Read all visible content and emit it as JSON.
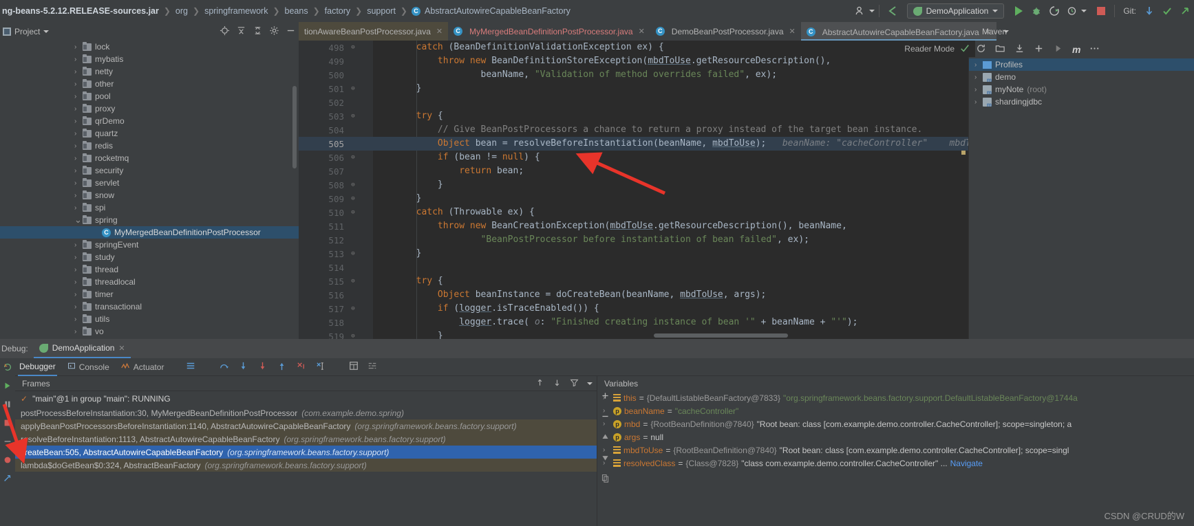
{
  "breadcrumb": {
    "jar": "ng-beans-5.2.12.RELEASE-sources.jar",
    "items": [
      "org",
      "springframework",
      "beans",
      "factory",
      "support"
    ],
    "class": "AbstractAutowireCapableBeanFactory",
    "class_icon": "C"
  },
  "toolbar": {
    "user_icon": "user-icon",
    "back_icon": "back-arrow-icon",
    "run_config": "DemoApplication",
    "run_icon": "run-icon",
    "debug_icon": "debug-icon",
    "coverage_icon": "run-with-coverage-icon",
    "profiler_icon": "profiler-icon",
    "stop_icon": "stop-icon",
    "git_label": "Git:",
    "git_update_icon": "git-update-icon",
    "git_commit_icon": "git-commit-icon",
    "git_push_icon": "git-push-icon"
  },
  "project_panel": {
    "title": "Project",
    "tools": [
      "locate-icon",
      "collapse-all-icon",
      "expand-icon",
      "settings-gear-icon",
      "hide-icon"
    ],
    "tree": [
      {
        "label": "lock",
        "type": "folder",
        "expanded": false
      },
      {
        "label": "mybatis",
        "type": "folder",
        "expanded": false
      },
      {
        "label": "netty",
        "type": "folder",
        "expanded": false
      },
      {
        "label": "other",
        "type": "folder",
        "expanded": false
      },
      {
        "label": "pool",
        "type": "folder",
        "expanded": false
      },
      {
        "label": "proxy",
        "type": "folder",
        "expanded": false
      },
      {
        "label": "qrDemo",
        "type": "folder",
        "expanded": false
      },
      {
        "label": "quartz",
        "type": "folder",
        "expanded": false
      },
      {
        "label": "redis",
        "type": "folder",
        "expanded": false
      },
      {
        "label": "rocketmq",
        "type": "folder",
        "expanded": false
      },
      {
        "label": "security",
        "type": "folder",
        "expanded": false
      },
      {
        "label": "servlet",
        "type": "folder",
        "expanded": false
      },
      {
        "label": "snow",
        "type": "folder",
        "expanded": false
      },
      {
        "label": "spi",
        "type": "folder",
        "expanded": false
      },
      {
        "label": "spring",
        "type": "folder",
        "expanded": true
      },
      {
        "label": "MyMergedBeanDefinitionPostProcessor",
        "type": "class",
        "selected": true
      },
      {
        "label": "springEvent",
        "type": "folder",
        "expanded": false
      },
      {
        "label": "study",
        "type": "folder",
        "expanded": false
      },
      {
        "label": "thread",
        "type": "folder",
        "expanded": false
      },
      {
        "label": "threadlocal",
        "type": "folder",
        "expanded": false
      },
      {
        "label": "timer",
        "type": "folder",
        "expanded": false
      },
      {
        "label": "transactional",
        "type": "folder",
        "expanded": false
      },
      {
        "label": "utils",
        "type": "folder",
        "expanded": false
      },
      {
        "label": "vo",
        "type": "folder",
        "expanded": false
      }
    ]
  },
  "editor_tabs": [
    {
      "label": "tionAwareBeanPostProcessor.java",
      "style": "olive",
      "icon": "",
      "closable": true
    },
    {
      "label": "MyMergedBeanDefinitionPostProcessor.java",
      "style": "pink",
      "icon": "C",
      "closable": true
    },
    {
      "label": "DemoBeanPostProcessor.java",
      "style": "normal",
      "icon": "C",
      "closable": true
    },
    {
      "label": "AbstractAutowireCapableBeanFactory.java",
      "style": "active",
      "icon": "C",
      "closable": true
    }
  ],
  "editor": {
    "reader_mode": "Reader Mode",
    "inspection_icon": "inspections-ok-icon",
    "lines": [
      {
        "num": "498",
        "fold": "⊖",
        "code_html": "        catch (BeanDefinitionValidationException ex) {",
        "plain": "catch (BeanDefinitionValidationException ex) {"
      },
      {
        "num": "499",
        "fold": "",
        "code_html": "            throw new BeanDefinitionStoreException(mbdToUse.getResourceDescription(),",
        "plain": "throw new BeanDefinitionStoreException(mbdToUse.getResourceDescription(),"
      },
      {
        "num": "500",
        "fold": "",
        "code_html": "                    beanName, \"Validation of method overrides failed\", ex);",
        "plain": "beanName, \"Validation of method overrides failed\", ex);"
      },
      {
        "num": "501",
        "fold": "⊖",
        "code_html": "        }",
        "plain": "}"
      },
      {
        "num": "502",
        "fold": "",
        "code_html": "",
        "plain": ""
      },
      {
        "num": "503",
        "fold": "⊖",
        "code_html": "        try {",
        "plain": "try {"
      },
      {
        "num": "504",
        "fold": "",
        "code_html": "            // Give BeanPostProcessors a chance to return a proxy instead of the target bean instance.",
        "plain": "// Give BeanPostProcessors a chance to return a proxy instead of the target bean instance."
      },
      {
        "num": "505",
        "fold": "",
        "code_html": "            Object bean = resolveBeforeInstantiation(beanName, mbdToUse);",
        "plain": "Object bean = resolveBeforeInstantiation(beanName, mbdToUse);",
        "highlighted": true,
        "hints": "beanName: \"cacheController\"    mbdToUse: \"Root b"
      },
      {
        "num": "506",
        "fold": "⊖",
        "code_html": "            if (bean != null) {",
        "plain": "if (bean != null) {"
      },
      {
        "num": "507",
        "fold": "",
        "code_html": "                return bean;",
        "plain": "return bean;"
      },
      {
        "num": "508",
        "fold": "⊖",
        "code_html": "            }",
        "plain": "}"
      },
      {
        "num": "509",
        "fold": "⊖",
        "code_html": "        }",
        "plain": "}"
      },
      {
        "num": "510",
        "fold": "⊖",
        "code_html": "        catch (Throwable ex) {",
        "plain": "catch (Throwable ex) {"
      },
      {
        "num": "511",
        "fold": "",
        "code_html": "            throw new BeanCreationException(mbdToUse.getResourceDescription(), beanName,",
        "plain": "throw new BeanCreationException(mbdToUse.getResourceDescription(), beanName,"
      },
      {
        "num": "512",
        "fold": "",
        "code_html": "                    \"BeanPostProcessor before instantiation of bean failed\", ex);",
        "plain": "\"BeanPostProcessor before instantiation of bean failed\", ex);"
      },
      {
        "num": "513",
        "fold": "⊖",
        "code_html": "        }",
        "plain": "}"
      },
      {
        "num": "514",
        "fold": "",
        "code_html": "",
        "plain": ""
      },
      {
        "num": "515",
        "fold": "⊖",
        "code_html": "        try {",
        "plain": "try {"
      },
      {
        "num": "516",
        "fold": "",
        "code_html": "            Object beanInstance = doCreateBean(beanName, mbdToUse, args);",
        "plain": "Object beanInstance = doCreateBean(beanName, mbdToUse, args);"
      },
      {
        "num": "517",
        "fold": "⊖",
        "code_html": "            if (logger.isTraceEnabled()) {",
        "plain": "if (logger.isTraceEnabled()) {"
      },
      {
        "num": "518",
        "fold": "",
        "code_html": "                logger.trace( o: \"Finished creating instance of bean '\" + beanName + \"'\");",
        "plain": "logger.trace( o: \"Finished creating instance of bean '\" + beanName + \"'\");"
      },
      {
        "num": "519",
        "fold": "⊖",
        "code_html": "            }",
        "plain": "}"
      }
    ]
  },
  "maven_panel": {
    "title": "Maven",
    "tools": [
      "reload-icon",
      "add-maven-project-icon",
      "download-sources-icon",
      "add-icon",
      "run-icon",
      "execute-goal-icon",
      "more-icon"
    ],
    "tree": [
      {
        "label": "Profiles",
        "icon": "profiles-icon",
        "selected": true,
        "suffix": ""
      },
      {
        "label": "demo",
        "icon": "maven-module-icon",
        "selected": false,
        "suffix": ""
      },
      {
        "label": "myNote",
        "icon": "maven-module-icon",
        "selected": false,
        "suffix": "(root)"
      },
      {
        "label": "shardingjdbc",
        "icon": "maven-module-icon",
        "selected": false,
        "suffix": ""
      }
    ]
  },
  "debug_panel": {
    "window_label": "Debug:",
    "session_name": "DemoApplication",
    "tabs": [
      {
        "label": "Debugger",
        "active": true,
        "icon": ""
      },
      {
        "label": "Console",
        "active": false,
        "icon": "console-icon"
      },
      {
        "label": "Actuator",
        "active": false,
        "icon": "actuator-icon"
      }
    ],
    "tools": [
      "layout-icon",
      "step-over-icon",
      "step-into-icon",
      "force-step-into-icon",
      "step-out-icon",
      "drop-frame-icon",
      "run-to-cursor-icon",
      "evaluate-icon",
      "settings-icon"
    ],
    "frames": {
      "header": "Frames",
      "thread": "\"main\"@1 in group \"main\": RUNNING",
      "tools": [
        "sort-up-icon",
        "sort-down-icon",
        "filter-icon",
        "chevron-down-icon"
      ],
      "rows": [
        {
          "method": "postProcessBeforeInstantiation:30, MyMergedBeanDefinitionPostProcessor",
          "pkg": "(com.example.demo.spring)",
          "style": "normal"
        },
        {
          "method": "applyBeanPostProcessorsBeforeInstantiation:1140, AbstractAutowireCapableBeanFactory",
          "pkg": "(org.springframework.beans.factory.support)",
          "style": "olive"
        },
        {
          "method": "resolveBeforeInstantiation:1113, AbstractAutowireCapableBeanFactory",
          "pkg": "(org.springframework.beans.factory.support)",
          "style": "olive"
        },
        {
          "method": "createBean:505, AbstractAutowireCapableBeanFactory",
          "pkg": "(org.springframework.beans.factory.support)",
          "style": "selected"
        },
        {
          "method": "lambda$doGetBean$0:324, AbstractBeanFactory",
          "pkg": "(org.springframework.beans.factory.support)",
          "style": "olive"
        }
      ]
    },
    "variables": {
      "header": "Variables",
      "tools": [
        "add-watch-icon",
        "remove-watch-icon",
        "up-icon",
        "down-icon",
        "copy-icon"
      ],
      "rows": [
        {
          "icon": "list-icon",
          "name": "this",
          "eq": "=",
          "ref": "{DefaultListableBeanFactory@7833}",
          "value": "\"org.springframework.beans.factory.support.DefaultListableBeanFactory@1744a",
          "value_kind": "string",
          "expandable": true
        },
        {
          "icon": "param-icon",
          "name": "beanName",
          "eq": "=",
          "ref": "",
          "value": "\"cacheController\"",
          "value_kind": "string",
          "expandable": true
        },
        {
          "icon": "param-icon",
          "name": "mbd",
          "eq": "=",
          "ref": "{RootBeanDefinition@7840}",
          "value": "\"Root bean: class [com.example.demo.controller.CacheController]; scope=singleton; a",
          "value_kind": "plain",
          "expandable": true
        },
        {
          "icon": "param-icon",
          "name": "args",
          "eq": "=",
          "ref": "",
          "value": "null",
          "value_kind": "plain",
          "expandable": false
        },
        {
          "icon": "list-icon",
          "name": "mbdToUse",
          "eq": "=",
          "ref": "{RootBeanDefinition@7840}",
          "value": "\"Root bean: class [com.example.demo.controller.CacheController]; scope=singl",
          "value_kind": "plain",
          "expandable": true
        },
        {
          "icon": "list-icon",
          "name": "resolvedClass",
          "eq": "=",
          "ref": "{Class@7828}",
          "value": "\"class com.example.demo.controller.CacheController\" ...",
          "value_kind": "plain",
          "expandable": true,
          "link": "Navigate"
        }
      ]
    }
  },
  "watermark": "CSDN @CRUD的W",
  "colors": {
    "accent_blue": "#2f63ad",
    "selection_tree": "#2d4f6b",
    "editor_bg": "#2b2b2b",
    "panel_bg": "#3c3f41",
    "olive_row": "#4e4a3d",
    "annotation_red": "#e8342a",
    "keyword_orange": "#cc7832",
    "string_green": "#6a8759"
  }
}
